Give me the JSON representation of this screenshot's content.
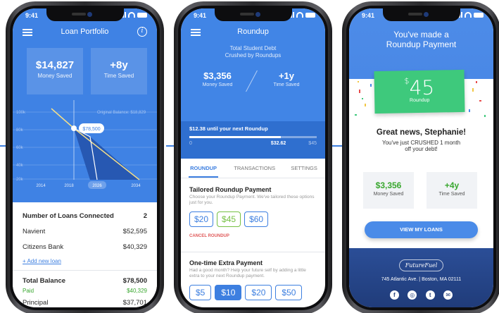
{
  "status_time": "9:41",
  "phone1": {
    "title": "Loan Portfolio",
    "money_saved_value": "$14,827",
    "money_saved_label": "Money Saved",
    "time_saved_value": "+8y",
    "time_saved_label": "Time Saved",
    "chart_original_balance": "Original Balance: $18,829",
    "chart_tooltip": "$78,500",
    "chart_y_ticks": [
      "100k",
      "80k",
      "60k",
      "40k",
      "20k"
    ],
    "chart_x_ticks": [
      "2014",
      "2018",
      "2026",
      "2034"
    ],
    "loans_header_label": "Number of Loans Connected",
    "loans_header_value": "2",
    "loans": [
      {
        "name": "Navient",
        "amount": "$52,595"
      },
      {
        "name": "Citizens Bank",
        "amount": "$40,329"
      }
    ],
    "add_loan_link": "+ Add new loan",
    "total_balance_label": "Total Balance",
    "total_balance_value": "$78,500",
    "paid_label": "Paid",
    "paid_value": "$40,329",
    "principal_label": "Principal",
    "principal_value": "$37,701"
  },
  "phone2": {
    "title": "Roundup",
    "subtitle_line1": "Total Student Debt",
    "subtitle_line2": "Crushed by Roundups",
    "money_saved_value": "$3,356",
    "money_saved_label": "Money Saved",
    "time_saved_value": "+1y",
    "time_saved_label": "Time Saved",
    "progress_label": "$12.38 until your next Roundup",
    "progress_min": "0",
    "progress_current": "$32.62",
    "progress_max": "$45",
    "progress_fraction": 0.72,
    "tabs": [
      "ROUNDUP",
      "TRANSACTIONS",
      "SETTINGS"
    ],
    "tailored_title": "Tailored Roundup Payment",
    "tailored_desc": "Choose your Roundup Payment. We've tailored these options just for you.",
    "tailored_options": [
      "$20",
      "$45",
      "$60"
    ],
    "cancel_label": "CANCEL ROUNDUP",
    "onetime_title": "One-time Extra Payment",
    "onetime_desc": "Had a good month? Help your future self by adding a little extra to your next Roundup payment.",
    "onetime_options": [
      "$5",
      "$10",
      "$20",
      "$50"
    ]
  },
  "phone3": {
    "headline_line1": "You've made a",
    "headline_line2": "Roundup Payment",
    "amount_currency": "$",
    "amount_value": "45",
    "amount_label": "Roundup",
    "congrats": "Great news, Stephanie!",
    "message_line1": "You've just CRUSHED 1 month",
    "message_line2": "off your debt!",
    "money_saved_value": "$3,356",
    "money_saved_label": "Money Saved",
    "time_saved_value": "+4y",
    "time_saved_label": "Time Saved",
    "cta_label": "VIEW MY LOANS",
    "brand": "FutureFuel",
    "address": "745 Atlantic Ave. | Boston, MA 02111",
    "social_icons": [
      "facebook-icon",
      "instagram-icon",
      "twitter-icon",
      "email-icon"
    ]
  }
}
